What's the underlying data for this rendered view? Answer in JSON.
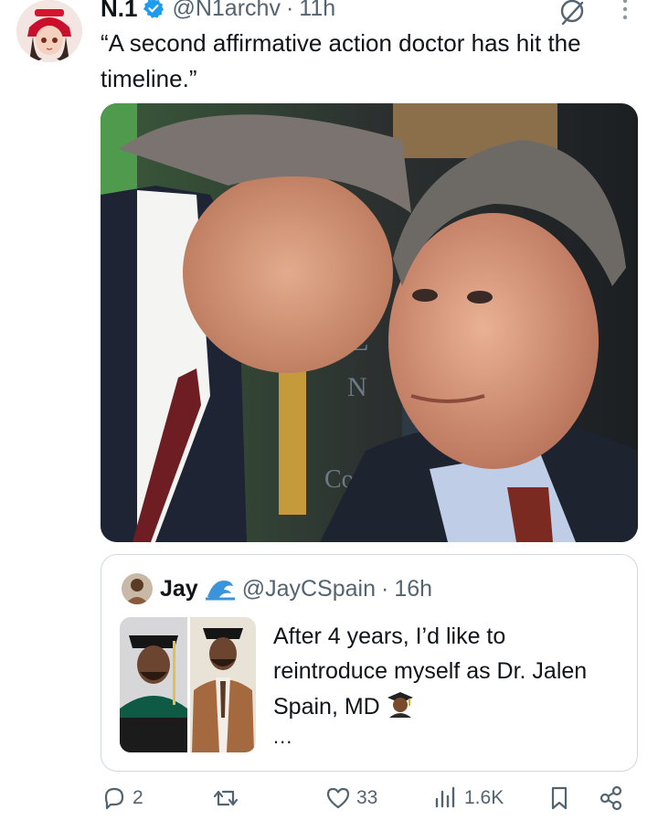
{
  "tweet": {
    "display_name": "N.1",
    "handle": "@N1archv",
    "separator": "·",
    "time": "11h",
    "text": "“A second affirmative action doctor has hit the timeline.”",
    "icons": {
      "verified": "verified-badge-icon",
      "grok": "grok-icon",
      "more": "more-options-icon"
    },
    "colors": {
      "verified": "#1d9bf0",
      "secondary_text": "#536471"
    }
  },
  "quote": {
    "display_name": "Jay",
    "handle": "@JayCSpain",
    "separator": "·",
    "time": "16h",
    "text": "After 4 years, I’d like to reintroduce myself as Dr. Jalen Spain, MD",
    "truncation": "...",
    "icons": {
      "wave": "water-wave-emoji",
      "graduate": "graduate-emoji"
    }
  },
  "actions": {
    "replies": "2",
    "retweets": "",
    "likes": "33",
    "views": "1.6K"
  }
}
